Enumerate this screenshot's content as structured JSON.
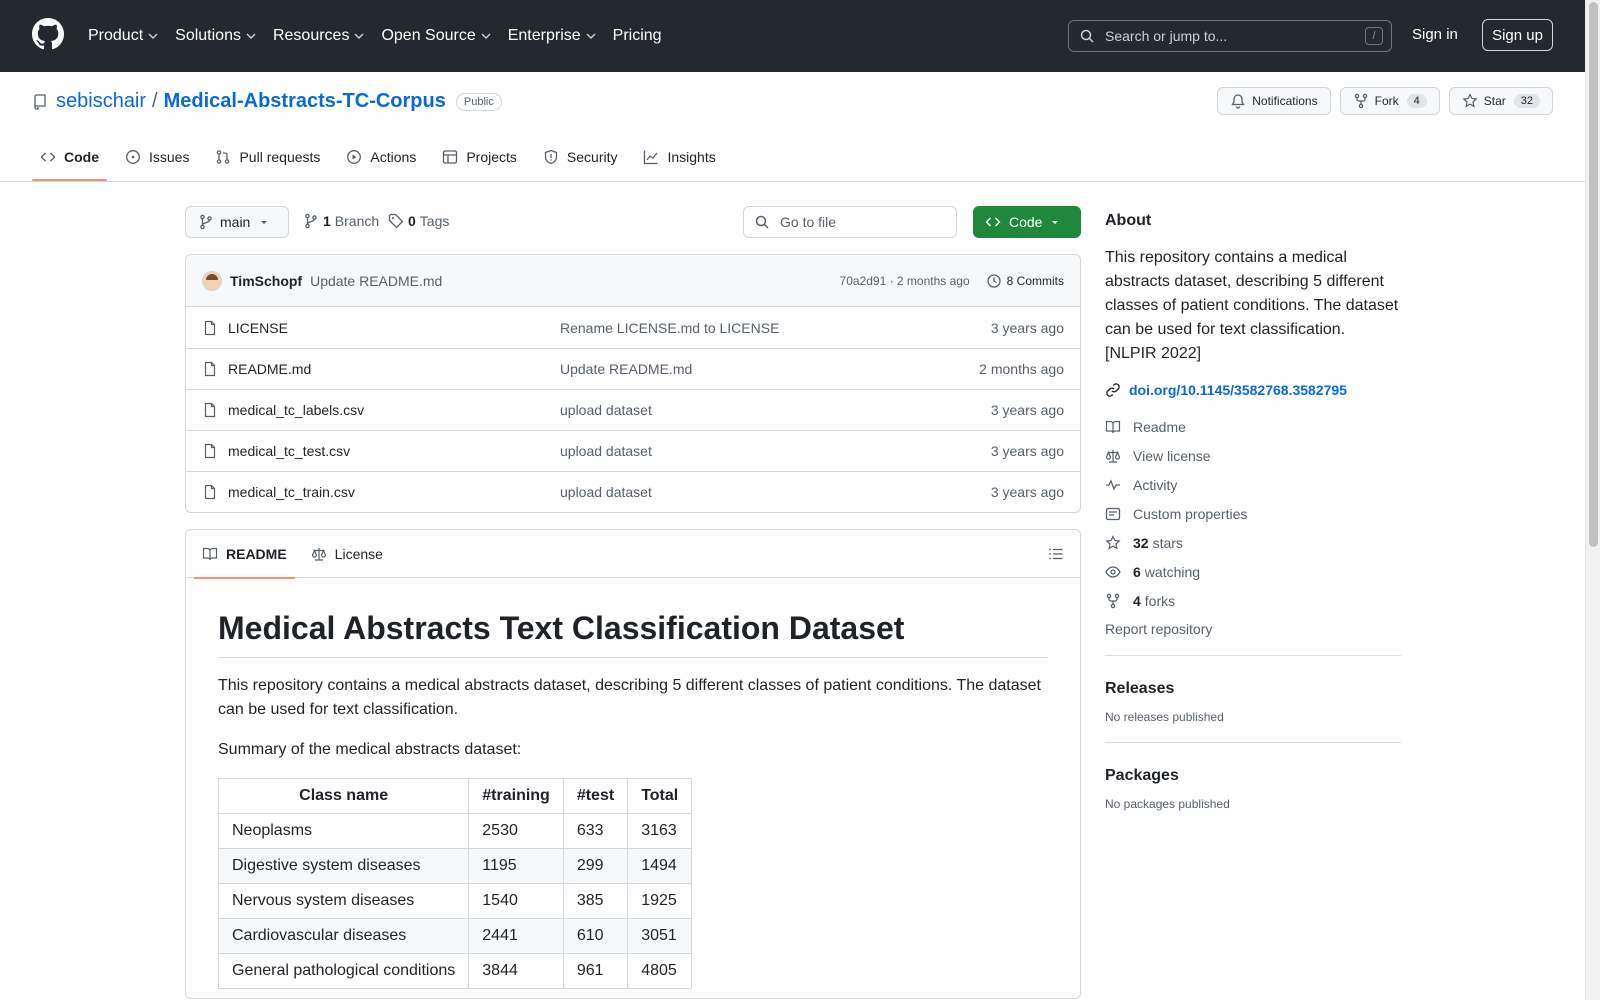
{
  "header": {
    "nav": [
      {
        "label": "Product",
        "dropdown": true
      },
      {
        "label": "Solutions",
        "dropdown": true
      },
      {
        "label": "Resources",
        "dropdown": true
      },
      {
        "label": "Open Source",
        "dropdown": true
      },
      {
        "label": "Enterprise",
        "dropdown": true
      },
      {
        "label": "Pricing",
        "dropdown": false
      }
    ],
    "search_placeholder": "Search or jump to...",
    "search_shortcut": "/",
    "sign_in": "Sign in",
    "sign_up": "Sign up"
  },
  "repo": {
    "owner": "sebischair",
    "separator": "/",
    "name": "Medical-Abstracts-TC-Corpus",
    "visibility": "Public",
    "notifications_label": "Notifications",
    "fork_label": "Fork",
    "fork_count": "4",
    "star_label": "Star",
    "star_count": "32",
    "tabs": [
      "Code",
      "Issues",
      "Pull requests",
      "Actions",
      "Projects",
      "Security",
      "Insights"
    ]
  },
  "toolbar": {
    "branch": "main",
    "branch_count": "1",
    "branch_label": "Branch",
    "tag_count": "0",
    "tag_label": "Tags",
    "goto_placeholder": "Go to file",
    "code_button": "Code"
  },
  "commit": {
    "author": "TimSchopf",
    "message": "Update README.md",
    "hash_time": "70a2d91 · 2 months ago",
    "commits_label": "8 Commits"
  },
  "files": [
    {
      "name": "LICENSE",
      "message": "Rename LICENSE.md to LICENSE",
      "time": "3 years ago"
    },
    {
      "name": "README.md",
      "message": "Update README.md",
      "time": "2 months ago"
    },
    {
      "name": "medical_tc_labels.csv",
      "message": "upload dataset",
      "time": "3 years ago"
    },
    {
      "name": "medical_tc_test.csv",
      "message": "upload dataset",
      "time": "3 years ago"
    },
    {
      "name": "medical_tc_train.csv",
      "message": "upload dataset",
      "time": "3 years ago"
    }
  ],
  "readme": {
    "tab_readme": "README",
    "tab_license": "License",
    "title": "Medical Abstracts Text Classification Dataset",
    "intro": "This repository contains a medical abstracts dataset, describing 5 different classes of patient conditions. The dataset can be used for text classification.",
    "summary": "Summary of the medical abstracts dataset:",
    "table_headers": [
      "Class name",
      "#training",
      "#test",
      "Total"
    ],
    "table_rows": [
      [
        "Neoplasms",
        "2530",
        "633",
        "3163"
      ],
      [
        "Digestive system diseases",
        "1195",
        "299",
        "1494"
      ],
      [
        "Nervous system diseases",
        "1540",
        "385",
        "1925"
      ],
      [
        "Cardiovascular diseases",
        "2441",
        "610",
        "3051"
      ],
      [
        "General pathological conditions",
        "3844",
        "961",
        "4805"
      ]
    ]
  },
  "about": {
    "heading": "About",
    "description": "This repository contains a medical abstracts dataset, describing 5 different classes of patient conditions. The dataset can be used for text classification. [NLPIR 2022]",
    "doi": "doi.org/10.1145/3582768.3582795",
    "readme": "Readme",
    "license": "View license",
    "activity": "Activity",
    "custom_properties": "Custom properties",
    "stars_count": "32",
    "stars_label": "stars",
    "watching_count": "6",
    "watching_label": "watching",
    "forks_count": "4",
    "forks_label": "forks",
    "report": "Report repository"
  },
  "releases": {
    "heading": "Releases",
    "text": "No releases published"
  },
  "packages": {
    "heading": "Packages",
    "text": "No packages published"
  },
  "colors": {
    "header_bg": "#24292f",
    "link": "#0969da",
    "primary_button": "#1f883d",
    "active_tab": "#fd8c73"
  }
}
